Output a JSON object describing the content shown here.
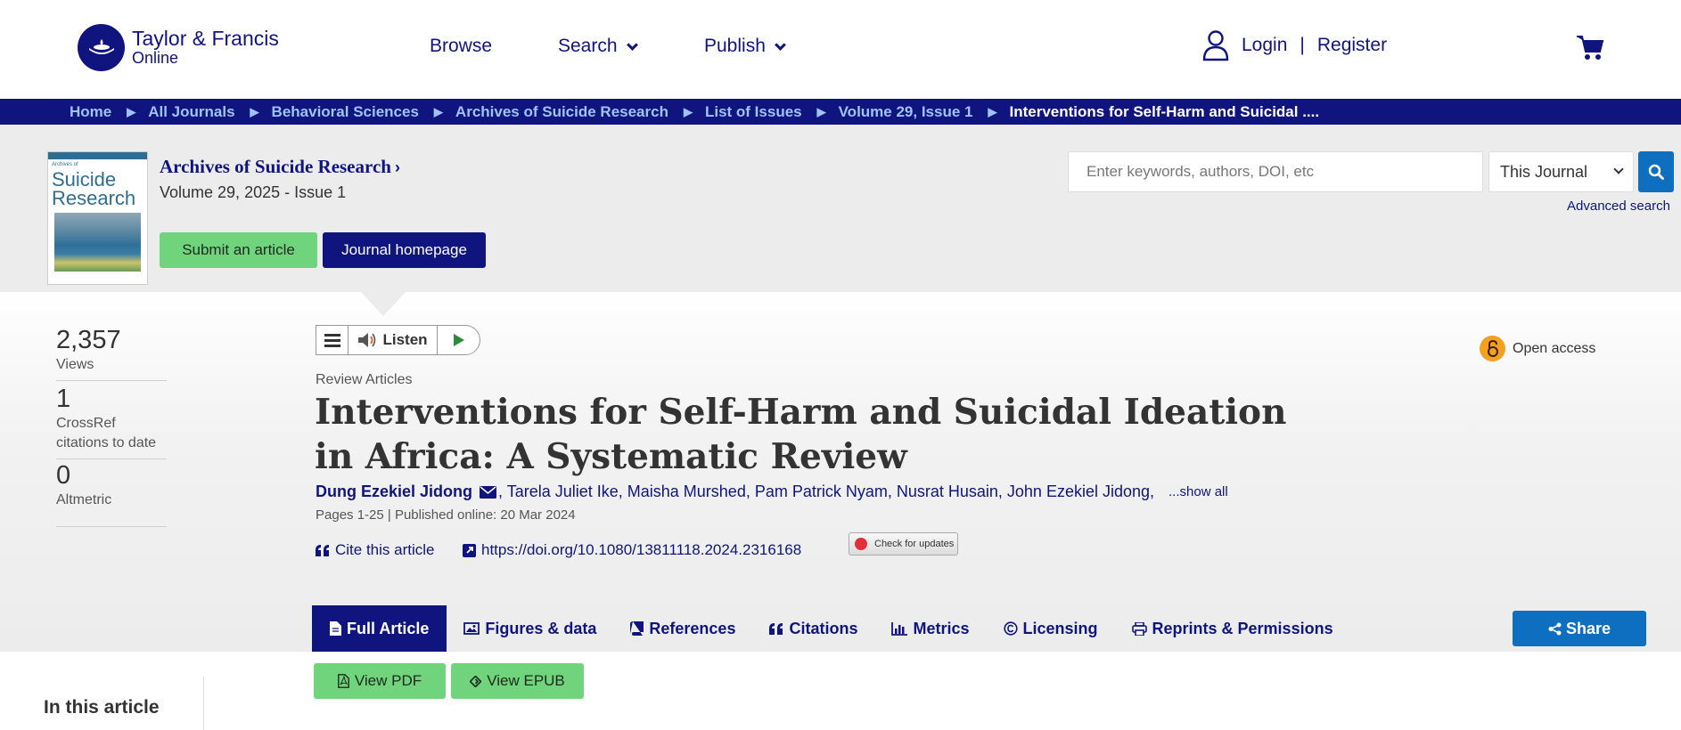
{
  "header": {
    "logo_line1": "Taylor & Francis",
    "logo_line2": "Online",
    "nav": [
      {
        "label": "Browse"
      },
      {
        "label": "Search"
      },
      {
        "label": "Publish"
      }
    ],
    "login": "Login",
    "separator": "|",
    "register": "Register"
  },
  "breadcrumb": [
    "Home",
    "All Journals",
    "Behavioral Sciences",
    "Archives of Suicide Research",
    "List of Issues",
    "Volume 29, Issue 1",
    "Interventions for Self-Harm and Suicidal ...."
  ],
  "breadcrumb_arrow": "▶",
  "journal": {
    "cover_title": "Suicide Research",
    "cover_small": "Archives of",
    "title": "Archives of Suicide Research",
    "volume": "Volume 29, 2025 - Issue 1",
    "submit_label": "Submit an article",
    "homepage_label": "Journal homepage"
  },
  "search": {
    "placeholder": "Enter keywords, authors, DOI, etc",
    "scope": "This Journal",
    "advanced": "Advanced search"
  },
  "metrics": [
    {
      "value": "2,357",
      "label": "Views"
    },
    {
      "value": "1",
      "label": "CrossRef citations to date"
    },
    {
      "value": "0",
      "label": "Altmetric"
    }
  ],
  "listen": {
    "label": "Listen"
  },
  "open_access": "Open access",
  "article": {
    "section": "Review Articles",
    "title": "Interventions for Self-Harm and Suicidal Ideation in Africa: A Systematic Review",
    "first_author": "Dung Ezekiel Jidong",
    "other_authors": ", Tarela Juliet Ike, Maisha Murshed, Pam Patrick Nyam, Nusrat Husain, John Ezekiel Jidong,",
    "show_all": "...show all",
    "pages": "Pages 1-25 | Published online: 20 Mar 2024",
    "cite": "Cite this article",
    "doi": "https://doi.org/10.1080/13811118.2024.2316168",
    "check_updates": "Check for updates"
  },
  "tabs": [
    {
      "label": "Full Article",
      "icon": "file-icon"
    },
    {
      "label": "Figures & data",
      "icon": "image-icon"
    },
    {
      "label": "References",
      "icon": "book-icon"
    },
    {
      "label": "Citations",
      "icon": "quote-icon"
    },
    {
      "label": "Metrics",
      "icon": "bar-chart-icon"
    },
    {
      "label": "Licensing",
      "icon": "copyright-icon"
    },
    {
      "label": "Reprints & Permissions",
      "icon": "print-icon"
    }
  ],
  "share": "Share",
  "view_pdf": "View PDF",
  "view_epub": "View EPUB",
  "in_this_article": "In this article",
  "colors": {
    "brand_navy": "#10147e",
    "green": "#6fd47c",
    "blue": "#0e6fc1",
    "open_access": "#f4a020"
  }
}
